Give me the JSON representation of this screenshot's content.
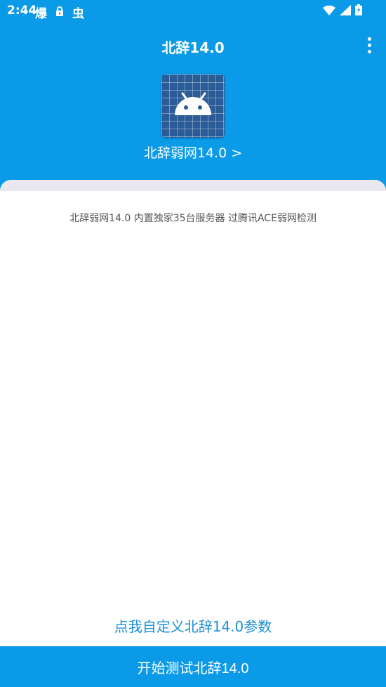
{
  "status_bar": {
    "time": "2:44",
    "notif_icons": [
      "爆",
      "lock-icon",
      "虫"
    ],
    "right_icons": [
      "wifi-icon",
      "cell-signal-icon",
      "battery-icon"
    ]
  },
  "app_bar": {
    "title": "北辞14.0",
    "menu_icon": "more-vert-icon"
  },
  "header": {
    "app_icon": "android-icon",
    "subtitle": "北辞弱网14.0 >"
  },
  "content": {
    "description": "北辞弱网14.0 内置独家35台服务器 过腾讯ACE弱网检测",
    "custom_link": "点我自定义北辞14.0参数"
  },
  "footer": {
    "start_label": "开始测试北辞14.0"
  },
  "colors": {
    "primary": "#0a9ae8",
    "link": "#1a8fd8",
    "icon_bg": "#2c5c98"
  }
}
